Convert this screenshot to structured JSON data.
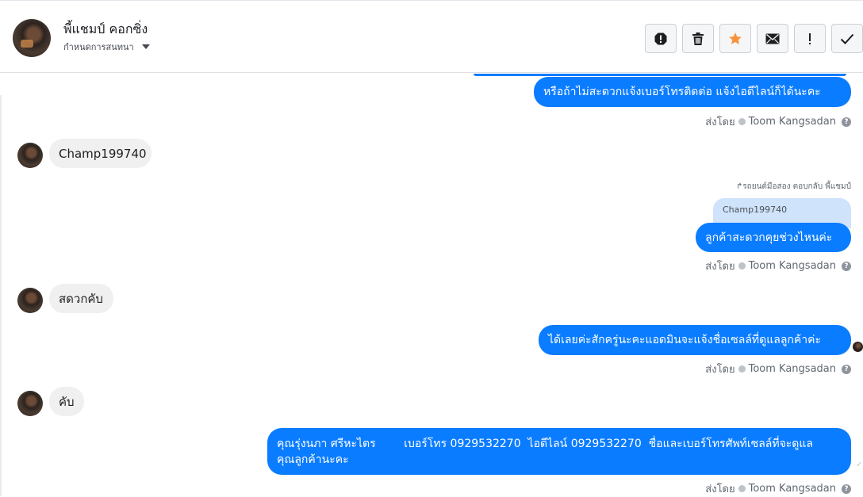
{
  "header": {
    "name": "พี้แชมป์ คอกซิ่ง",
    "assign_label": "กำหนดการสนทนา"
  },
  "actions": [
    {
      "name": "spam-button",
      "icon": "alert-circle-icon"
    },
    {
      "name": "delete-button",
      "icon": "trash-icon"
    },
    {
      "name": "star-button",
      "icon": "star-icon",
      "color": "#f7923a"
    },
    {
      "name": "mark-unread-button",
      "icon": "envelope-icon"
    },
    {
      "name": "important-button",
      "icon": "exclamation-icon"
    },
    {
      "name": "done-button",
      "icon": "check-icon"
    }
  ],
  "messages": {
    "m1": "หรือถ้าไม่สะดวกแจ้งเบอร์โทรติดต่อ แจ้งไอดีไลน์ก็ได้นะคะ",
    "m2": "Champ199740",
    "reply_note": "รถยนต์มือสอง ตอบกลับ พี้แชมป์",
    "reply_quote": "Champ199740",
    "m3": "ลูกค้าสะดวกคุยช่วงไหนค่ะ",
    "m4": "สดวกคับ",
    "m5": "ได้เลยค่ะสักครู่นะคะแอดมินจะแจ้งชื่อเซลล์ที่ดูแลลูกค้าค่ะ",
    "m6": "คับ",
    "m7_line1": "คุณรุ่งนภา ศรีหะไตร        เบอร์โทร 0929532270  ไอดีไลน์ 0929532270  ชื่อและเบอร์โทรศัพท์เซลล์ที่จะดูแล",
    "m7_line2": "คุณลูกค้านะคะ"
  },
  "sent_by": {
    "prefix": "ส่งโดย",
    "agent": "Toom Kangsadan"
  },
  "colors": {
    "outgoing": "#0a7cff",
    "incoming": "#f1f0f0",
    "reply_quote": "#cfe3fb"
  }
}
